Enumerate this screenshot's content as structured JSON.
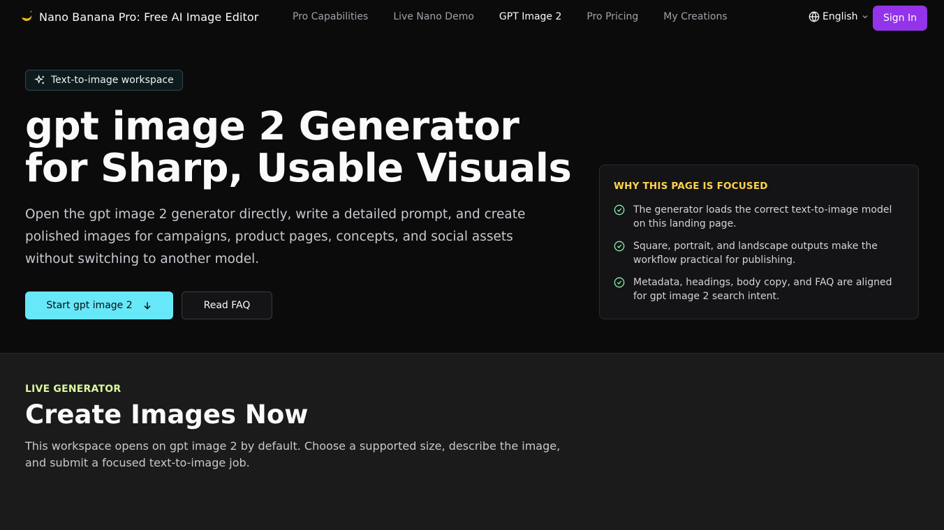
{
  "header": {
    "brand": "Nano Banana Pro: Free AI Image Editor",
    "nav": [
      {
        "label": "Pro Capabilities"
      },
      {
        "label": "Live Nano Demo"
      },
      {
        "label": "GPT Image 2"
      },
      {
        "label": "Pro Pricing"
      },
      {
        "label": "My Creations"
      }
    ],
    "active_nav": "GPT Image 2",
    "language": "English",
    "sign_in": "Sign In"
  },
  "hero": {
    "badge": "Text-to-image workspace",
    "title_line1": "gpt image 2 Generator",
    "title_line2": "for Sharp, Usable Visuals",
    "subtitle": "Open the gpt image 2 generator directly, write a detailed prompt, and create polished images for campaigns, product pages, concepts, and social assets without switching to another model.",
    "primary_button": "Start gpt image 2",
    "secondary_button": "Read FAQ"
  },
  "focus_card": {
    "title": "WHY THIS PAGE IS FOCUSED",
    "items": [
      "The generator loads the correct text-to-image model on this landing page.",
      "Square, portrait, and landscape outputs make the workflow practical for publishing.",
      "Metadata, headings, body copy, and FAQ are aligned for gpt image 2 search intent."
    ]
  },
  "generator_section": {
    "eyebrow": "LIVE GENERATOR",
    "title": "Create Images Now",
    "description": "This workspace opens on gpt image 2 by default. Choose a supported size, describe the image, and submit a focused text-to-image job."
  },
  "colors": {
    "accent_purple": "#9333ea",
    "accent_cyan": "#67e8f9",
    "card_title": "#fcd34d",
    "eyebrow": "#d9f99d",
    "check": "#86efac"
  }
}
